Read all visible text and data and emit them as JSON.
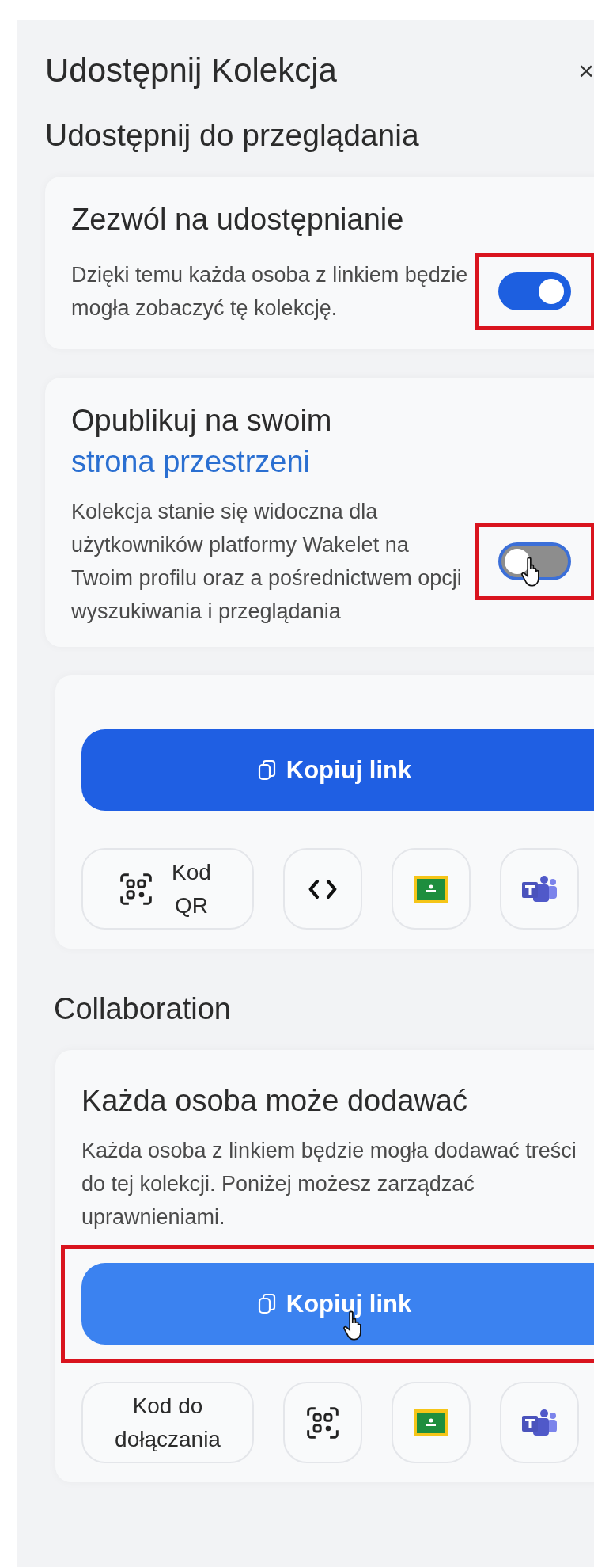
{
  "dialog": {
    "title": "Udostępnij Kolekcja",
    "close": "×"
  },
  "view": {
    "heading": "Udostępnij do przeglądania",
    "settings": [
      {
        "title": "Zezwól na udostępnianie",
        "description": "Dzięki temu każda osoba z linkiem będzie mogła zobaczyć tę kolekcję.",
        "on": true,
        "highlighted": true,
        "hovered": false
      },
      {
        "title": "Opublikuj na swoim",
        "title_link": "strona przestrzeni",
        "description": "Kolekcja stanie się widoczna dla użytkowników platformy Wakelet na Twoim profilu oraz a pośrednictwem opcji wyszukiwania i przeglądania",
        "on": false,
        "highlighted": true,
        "hovered": true
      }
    ],
    "copy_button": {
      "label": "Kopiuj link",
      "highlighted": false,
      "hovered": false
    },
    "options": [
      {
        "kind": "qr",
        "label": "Kod QR"
      },
      {
        "kind": "embed"
      },
      {
        "kind": "classroom"
      },
      {
        "kind": "teams"
      }
    ]
  },
  "collaboration": {
    "heading": "Collaboration",
    "title": "Każda osoba może dodawać",
    "description": "Każda osoba z linkiem będzie mogła dodawać treści do tej kolekcji. Poniżej możesz zarządzać uprawnieniami.",
    "copy_button": {
      "label": "Kopiuj link",
      "highlighted": true,
      "hovered": true
    },
    "options": [
      {
        "kind": "text",
        "label": "Kod do dołączania"
      },
      {
        "kind": "qr"
      },
      {
        "kind": "classroom"
      },
      {
        "kind": "teams"
      }
    ]
  }
}
